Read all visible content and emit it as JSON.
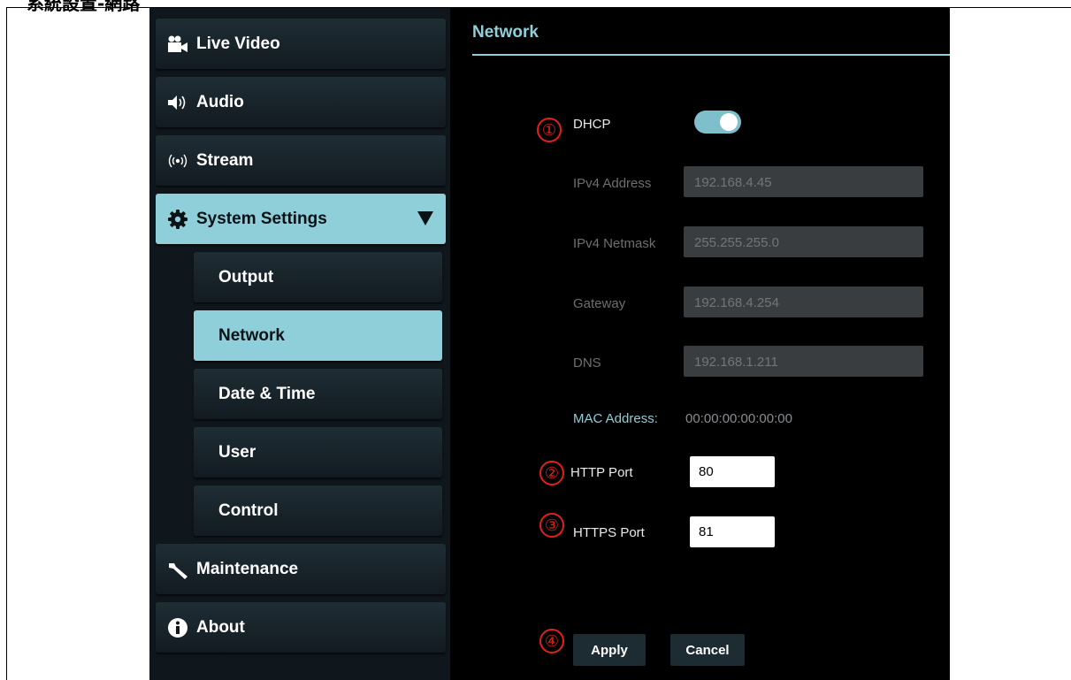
{
  "doc_heading": "系統設置-網路",
  "sidebar": {
    "items": [
      {
        "label": "Live Video",
        "icon": "video-camera-icon"
      },
      {
        "label": "Audio",
        "icon": "speaker-icon"
      },
      {
        "label": "Stream",
        "icon": "broadcast-icon"
      },
      {
        "label": "System Settings",
        "icon": "gear-icon",
        "expanded": true
      },
      {
        "label": "Maintenance",
        "icon": "wrench-icon"
      },
      {
        "label": "About",
        "icon": "info-icon"
      }
    ],
    "sub_items": [
      {
        "label": "Output"
      },
      {
        "label": "Network",
        "active": true
      },
      {
        "label": "Date & Time"
      },
      {
        "label": "User"
      },
      {
        "label": "Control"
      }
    ]
  },
  "main": {
    "title": "Network",
    "markers": [
      "①",
      "②",
      "③",
      "④"
    ],
    "dhcp": {
      "label": "DHCP",
      "enabled": true
    },
    "ipv4_address": {
      "label": "IPv4 Address",
      "value": "192.168.4.45"
    },
    "ipv4_netmask": {
      "label": "IPv4 Netmask",
      "value": "255.255.255.0"
    },
    "gateway": {
      "label": "Gateway",
      "value": "192.168.4.254"
    },
    "dns": {
      "label": "DNS",
      "value": "192.168.1.211"
    },
    "mac": {
      "label": "MAC Address:",
      "value": "00:00:00:00:00:00"
    },
    "http_port": {
      "label": "HTTP Port",
      "value": "80"
    },
    "https_port": {
      "label": "HTTPS Port",
      "value": "81"
    },
    "apply_label": "Apply",
    "cancel_label": "Cancel"
  },
  "colors": {
    "accent": "#8ecfd9",
    "marker": "#e0201a",
    "background": "#000000"
  }
}
